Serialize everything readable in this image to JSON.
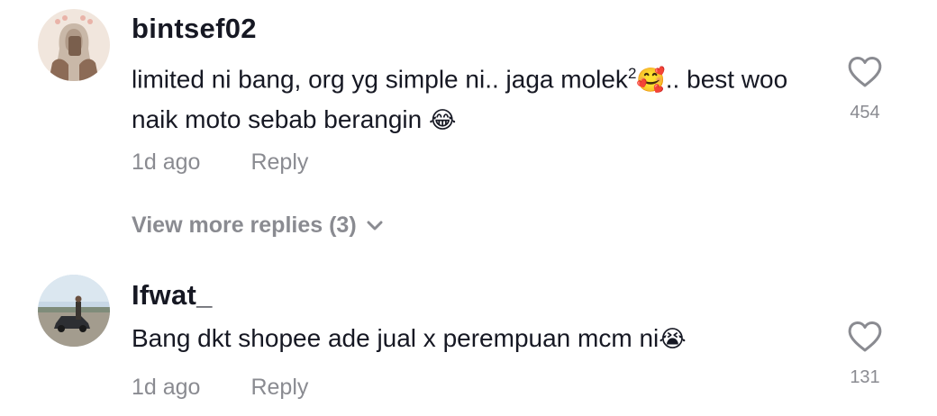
{
  "comments": [
    {
      "username": "bintsef02",
      "text_part1": "limited ni bang, org yg simple ni.. jaga molek",
      "superscript": "2",
      "emoji1": "🥰",
      "text_part2": ".. best woo naik moto sebab berangin ",
      "emoji2": "😂",
      "time": "1d ago",
      "reply_label": "Reply",
      "like_count": "454",
      "avatar_icon": "hijab-selfie-avatar"
    },
    {
      "username": "Ifwat_",
      "text_part1": "Bang dkt shopee ade jual x perempuan mcm ni",
      "emoji1": "😭",
      "time": "1d ago",
      "reply_label": "Reply",
      "like_count": "131",
      "avatar_icon": "person-with-car-avatar"
    }
  ],
  "view_more": {
    "label": "View more replies (3)",
    "icon": "chevron-down-icon"
  },
  "colors": {
    "primary_text": "#161823",
    "secondary_text": "#8a8b91"
  }
}
